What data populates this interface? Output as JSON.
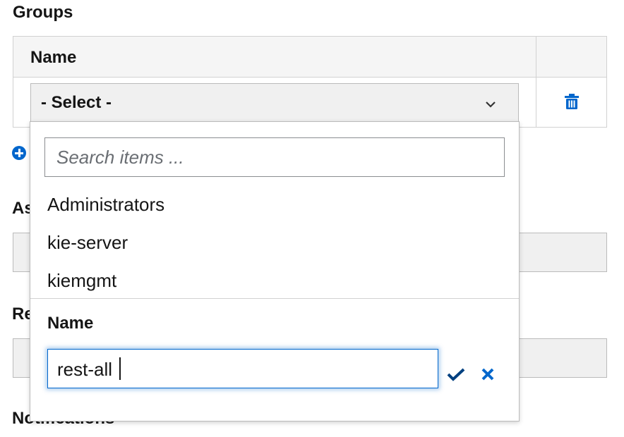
{
  "groups_section": {
    "title": "Groups",
    "table": {
      "column_header": "Name",
      "row": {
        "select_label": "- Select -"
      }
    }
  },
  "background_labels": {
    "assigned": "As",
    "required": "Re",
    "notifications": "Notifications"
  },
  "dropdown": {
    "search_placeholder": "Search items ...",
    "items": [
      "Administrators",
      "kie-server",
      "kiemgmt"
    ],
    "new_item": {
      "label": "Name",
      "value": "rest-all"
    }
  },
  "colors": {
    "accent": "#0066cc",
    "confirm": "#004080",
    "header_bg": "#f5f5f5"
  },
  "icons": {
    "chevron": "chevron-down-icon",
    "trash": "trash-icon",
    "add": "plus-circle-icon",
    "confirm": "check-icon",
    "cancel": "close-icon"
  }
}
